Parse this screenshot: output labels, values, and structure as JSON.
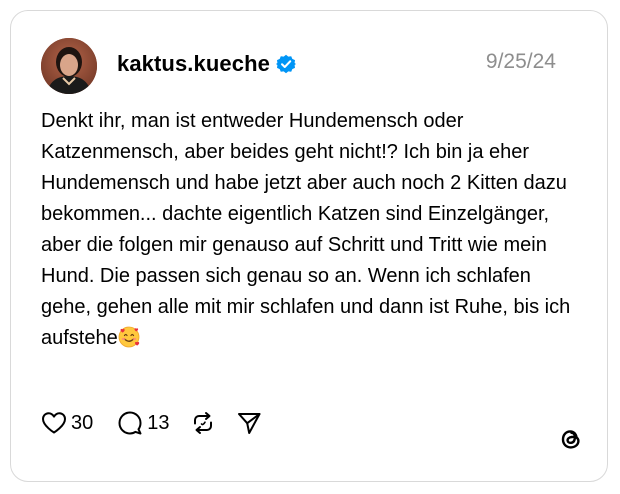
{
  "post": {
    "username": "kaktus.kueche",
    "date": "9/25/24",
    "verified": true,
    "text": "Denkt ihr, man ist entweder Hundemensch oder Katzenmensch, aber beides geht nicht!? Ich bin ja eher Hundemensch und habe jetzt aber auch noch 2 Kitten dazu bekommen... dachte eigentlich Katzen sind Einzelgänger, aber die folgen mir genauso auf Schritt und Tritt wie mein Hund. Die passen sich genau so an. Wenn ich schlafen gehe, gehen alle mit mir schlafen und dann ist Ruhe, bis ich aufstehe",
    "trailing_emoji": "smiling-face-with-hearts"
  },
  "actions": {
    "likes": "30",
    "replies": "13",
    "like_icon": "heart-icon",
    "reply_icon": "speech-bubble-icon",
    "repost_icon": "repost-icon",
    "share_icon": "send-icon"
  },
  "colors": {
    "verified_blue": "#0095f6",
    "date_gray": "#8e8e8e",
    "border": "#d9d9d9"
  },
  "brand": {
    "logo_icon": "threads-logo-icon"
  }
}
